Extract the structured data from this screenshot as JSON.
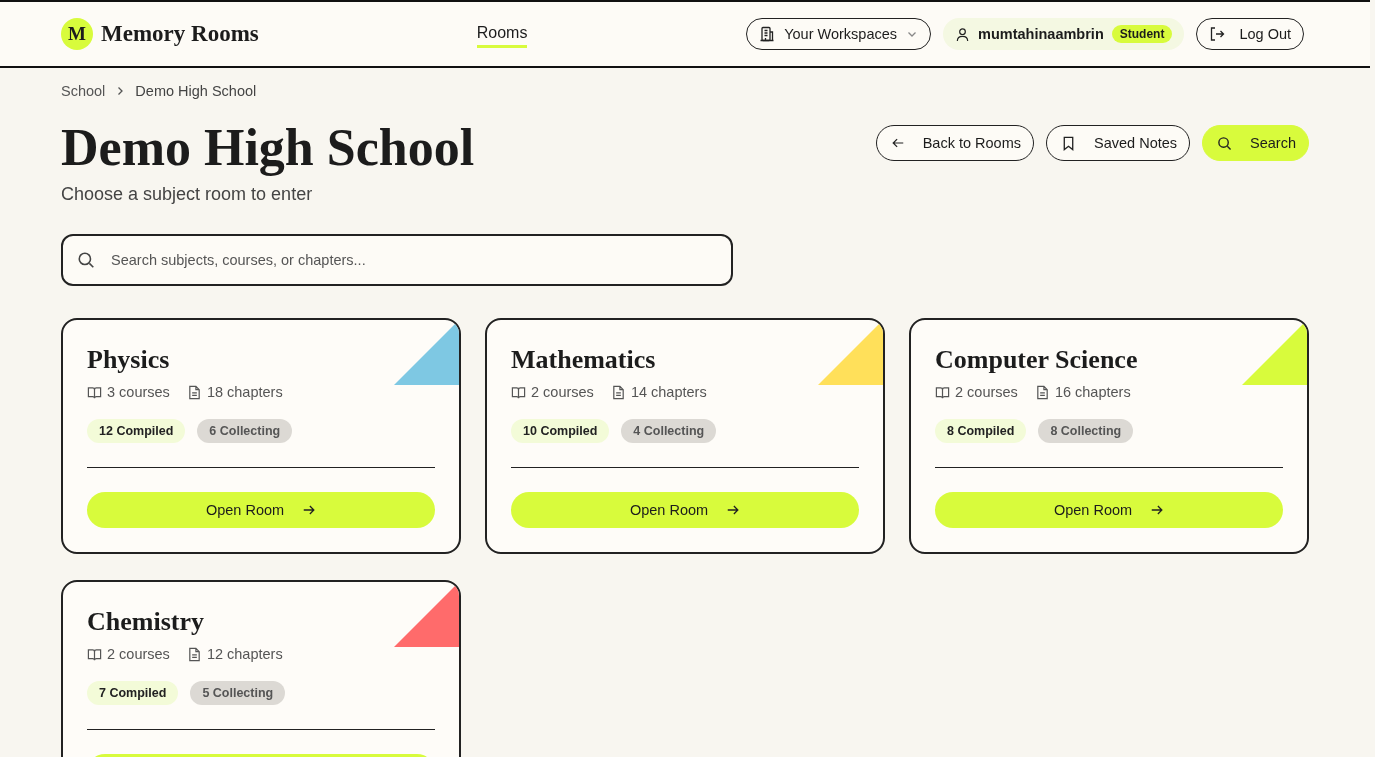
{
  "header": {
    "logo_letter": "M",
    "brand": "Memory Rooms",
    "nav": [
      {
        "label": "Rooms",
        "selected": true
      }
    ],
    "workspaces": "Your Workspaces",
    "user": "mumtahinaambrin",
    "role": "Student",
    "logout": "Log Out"
  },
  "breadcrumb": [
    "School",
    "Demo High School"
  ],
  "page": {
    "title": "Demo High School",
    "subtitle": "Choose a subject room to enter",
    "actions": [
      {
        "label": "Back to Rooms",
        "kind": "back"
      },
      {
        "label": "Saved Notes",
        "kind": "saved"
      },
      {
        "label": "Search",
        "kind": "search"
      }
    ]
  },
  "search": {
    "placeholder": "Search subjects, courses, or chapters..."
  },
  "rooms": [
    {
      "name": "Physics",
      "color": "#7ec8e3",
      "courses": "3 courses",
      "chapters": "18 chapters",
      "compiled": "12 Compiled",
      "collecting": "6 Collecting",
      "button": "Open Room"
    },
    {
      "name": "Mathematics",
      "color": "#ffe05a",
      "courses": "2 courses",
      "chapters": "14 chapters",
      "compiled": "10 Compiled",
      "collecting": "4 Collecting",
      "button": "Open Room"
    },
    {
      "name": "Computer Science",
      "color": "#d8fb3c",
      "courses": "2 courses",
      "chapters": "16 chapters",
      "compiled": "8 Compiled",
      "collecting": "8 Collecting",
      "button": "Open Room"
    },
    {
      "name": "Chemistry",
      "color": "#ff6b6b",
      "courses": "2 courses",
      "chapters": "12 chapters",
      "compiled": "7 Compiled",
      "collecting": "5 Collecting"
    }
  ]
}
